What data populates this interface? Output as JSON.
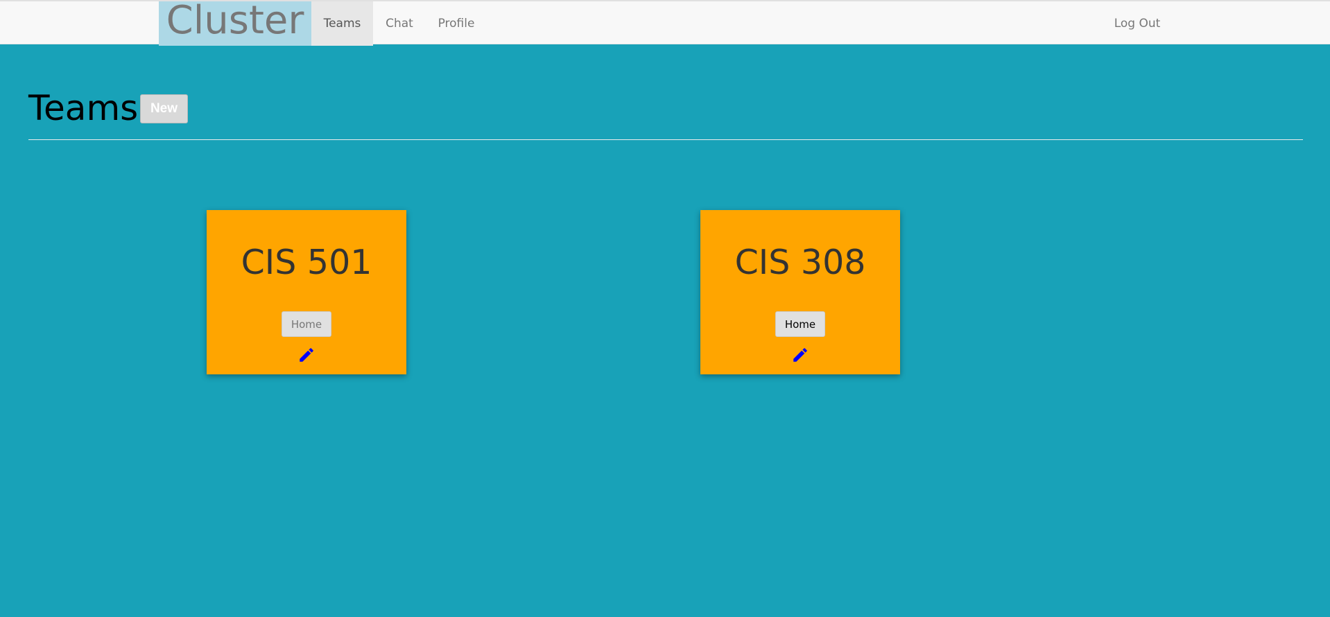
{
  "navbar": {
    "brand": "Cluster",
    "links": [
      {
        "label": "Teams",
        "active": true
      },
      {
        "label": "Chat"
      },
      {
        "label": "Profile"
      }
    ],
    "logout": "Log Out"
  },
  "header": {
    "title": "Teams",
    "new_button": "New"
  },
  "teams": [
    {
      "name": "CIS 501",
      "home_label": "Home",
      "edit_icon": "pencil-icon"
    },
    {
      "name": "CIS 308",
      "home_label": "Home",
      "edit_icon": "pencil-icon"
    }
  ],
  "colors": {
    "page_background": "#18a2b8",
    "navbar_background": "#f8f8f8",
    "brand_background": "#add8e6",
    "card_background": "#ffa500",
    "edit_icon": "#0000ff"
  }
}
